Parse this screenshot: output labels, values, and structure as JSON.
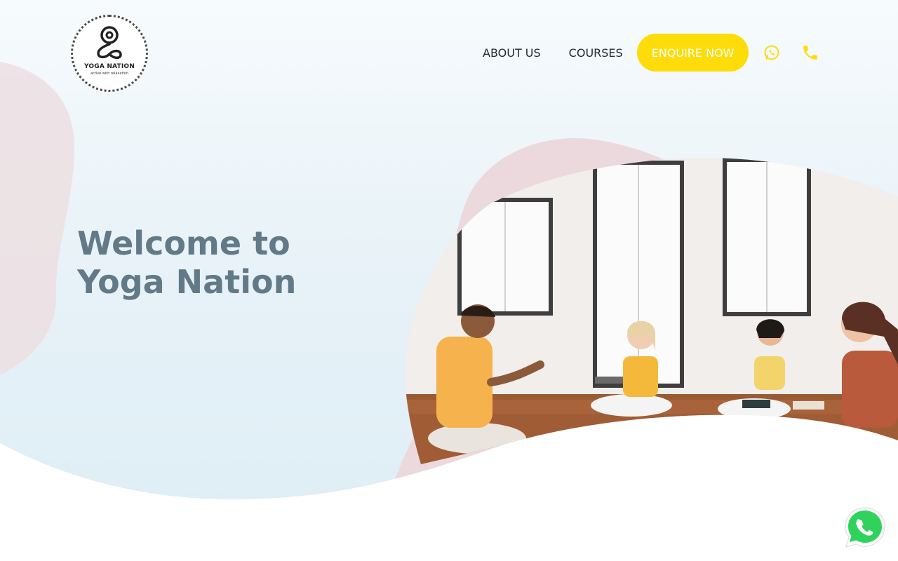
{
  "brand": {
    "logo_title": "YOGA NATION",
    "logo_tagline": "active with relaxation",
    "accent_color": "#fddc0a",
    "heading_color": "#627a87"
  },
  "nav": {
    "about_label": "ABOUT US",
    "courses_label": "COURSES",
    "enquire_label": "ENQUIRE NOW"
  },
  "hero": {
    "title_line1": "Welcome to",
    "title_line2": "Yoga Nation",
    "image_subject": "yoga instructor and students seated on a wooden studio floor"
  },
  "icons": {
    "header_whatsapp": "whatsapp-icon",
    "header_phone": "phone-icon",
    "floating_whatsapp": "whatsapp-icon"
  }
}
